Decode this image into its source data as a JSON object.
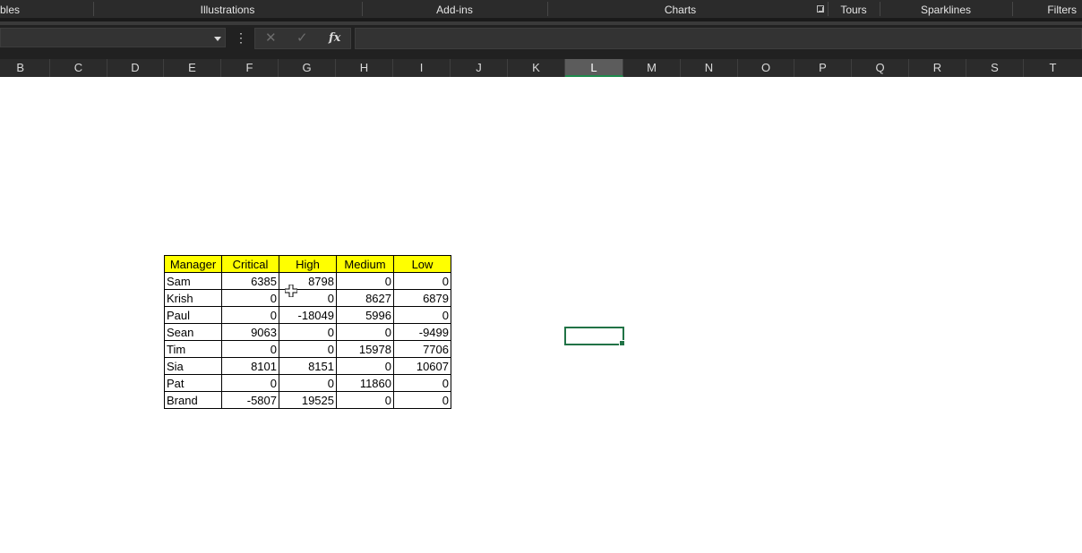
{
  "ribbon": {
    "groups": [
      "bles",
      "Illustrations",
      "Add-ins",
      "Charts",
      "Tours",
      "Sparklines",
      "Filters"
    ]
  },
  "formula_bar": {
    "name_box_value": "",
    "cancel_icon": "close-icon",
    "enter_icon": "check-icon",
    "fx_label": "fx",
    "formula_value": ""
  },
  "columns": [
    "B",
    "C",
    "D",
    "E",
    "F",
    "G",
    "H",
    "I",
    "J",
    "K",
    "L",
    "M",
    "N",
    "O",
    "P",
    "Q",
    "R",
    "S",
    "T"
  ],
  "selected_column": "L",
  "table": {
    "headers": [
      "Manager",
      "Critical",
      "High",
      "Medium",
      "Low"
    ],
    "rows": [
      [
        "Sam",
        "6385",
        "8798",
        "0",
        "0"
      ],
      [
        "Krish",
        "0",
        "0",
        "8627",
        "6879"
      ],
      [
        "Paul",
        "0",
        "-18049",
        "5996",
        "0"
      ],
      [
        "Sean",
        "9063",
        "0",
        "0",
        "-9499"
      ],
      [
        "Tim",
        "0",
        "0",
        "15978",
        "7706"
      ],
      [
        "Sia",
        "8101",
        "8151",
        "0",
        "10607"
      ],
      [
        "Pat",
        "0",
        "0",
        "11860",
        "0"
      ],
      [
        "Brand",
        "-5807",
        "19525",
        "0",
        "0"
      ]
    ],
    "header_fill": "#ffff00"
  },
  "colors": {
    "accent_green": "#217346",
    "ribbon_bg": "#2b2b2b"
  }
}
